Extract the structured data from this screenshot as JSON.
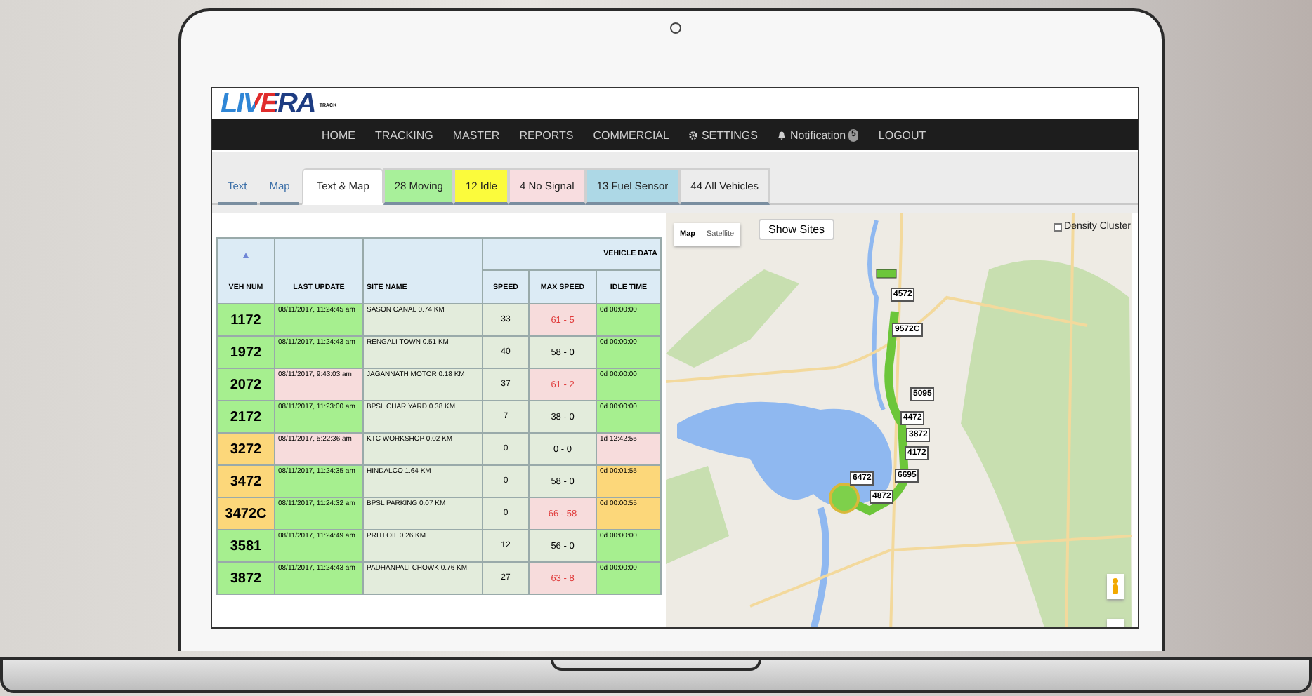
{
  "logo": {
    "brand": "LIVERA",
    "tagline": "TRACK"
  },
  "nav": [
    {
      "label": "HOME",
      "kind": "plain"
    },
    {
      "label": "TRACKING",
      "kind": "plain"
    },
    {
      "label": "MASTER",
      "kind": "plain"
    },
    {
      "label": "REPORTS",
      "kind": "plain"
    },
    {
      "label": "COMMERCIAL",
      "kind": "plain"
    },
    {
      "label": "SETTINGS",
      "kind": "gear"
    },
    {
      "label": "Notification",
      "kind": "bell",
      "badge": "5"
    },
    {
      "label": "LOGOUT",
      "kind": "plain"
    }
  ],
  "tabs": [
    {
      "label": "Text",
      "selected": false,
      "kind": "link"
    },
    {
      "label": "Map",
      "selected": false,
      "kind": "link"
    },
    {
      "label": "Text & Map",
      "selected": true,
      "kind": "tab"
    },
    {
      "label": "28 Moving",
      "selected": false,
      "kind": "tab",
      "color": "#a8f09a"
    },
    {
      "label": "12 Idle",
      "selected": false,
      "kind": "tab",
      "color": "#fbfb3c"
    },
    {
      "label": "4 No Signal",
      "selected": false,
      "kind": "tab",
      "color": "#f8dde0"
    },
    {
      "label": "13 Fuel Sensor",
      "selected": false,
      "kind": "tab",
      "color": "#add8e6"
    },
    {
      "label": "44 All Vehicles",
      "selected": false,
      "kind": "tab",
      "color": "#ececec"
    }
  ],
  "table": {
    "group_header": "VEHICLE DATA",
    "columns": [
      {
        "label": "VEH NUM",
        "sorted": true
      },
      {
        "label": "LAST UPDATE",
        "sorted": false
      },
      {
        "label": "SITE NAME",
        "sorted": false
      },
      {
        "label": "SPEED",
        "sorted": false
      },
      {
        "label": "MAX SPEED",
        "sorted": false
      },
      {
        "label": "IDLE TIME",
        "sorted": false
      }
    ],
    "rows": [
      {
        "veh_num": {
          "text": "1172",
          "color": "#a6ef8f"
        },
        "last_update": {
          "text": "08/11/2017, 11:24:45 am",
          "color": "#a6ef8f"
        },
        "site": "SASON CANAL 0.74 KM",
        "speed": "33",
        "max_speed": {
          "text": "61 - 5",
          "over_limit": true
        },
        "idle_time": {
          "text": "0d 00:00:00",
          "color": "#a6ef8f"
        }
      },
      {
        "veh_num": {
          "text": "1972",
          "color": "#a6ef8f"
        },
        "last_update": {
          "text": "08/11/2017, 11:24:43 am",
          "color": "#a6ef8f"
        },
        "site": "RENGALI TOWN 0.51 KM",
        "speed": "40",
        "max_speed": {
          "text": "58 - 0",
          "over_limit": false
        },
        "idle_time": {
          "text": "0d 00:00:00",
          "color": "#a6ef8f"
        }
      },
      {
        "veh_num": {
          "text": "2072",
          "color": "#a6ef8f"
        },
        "last_update": {
          "text": "08/11/2017, 9:43:03 am",
          "color": "#f7dcdc"
        },
        "site": "JAGANNATH MOTOR 0.18 KM",
        "speed": "37",
        "max_speed": {
          "text": "61 - 2",
          "over_limit": true
        },
        "idle_time": {
          "text": "0d 00:00:00",
          "color": "#a6ef8f"
        }
      },
      {
        "veh_num": {
          "text": "2172",
          "color": "#a6ef8f"
        },
        "last_update": {
          "text": "08/11/2017, 11:23:00 am",
          "color": "#a6ef8f"
        },
        "site": "BPSL CHAR YARD 0.38 KM",
        "speed": "7",
        "max_speed": {
          "text": "38 - 0",
          "over_limit": false
        },
        "idle_time": {
          "text": "0d 00:00:00",
          "color": "#a6ef8f"
        }
      },
      {
        "veh_num": {
          "text": "3272",
          "color": "#fcd77a"
        },
        "last_update": {
          "text": "08/11/2017, 5:22:36 am",
          "color": "#f7dcdc"
        },
        "site": "KTC WORKSHOP 0.02 KM",
        "speed": "0",
        "max_speed": {
          "text": "0 - 0",
          "over_limit": false
        },
        "idle_time": {
          "text": "1d 12:42:55",
          "color": "#f7dcdc"
        }
      },
      {
        "veh_num": {
          "text": "3472",
          "color": "#fcd77a"
        },
        "last_update": {
          "text": "08/11/2017, 11:24:35 am",
          "color": "#a6ef8f"
        },
        "site": "HINDALCO 1.64 KM",
        "speed": "0",
        "max_speed": {
          "text": "58 - 0",
          "over_limit": false
        },
        "idle_time": {
          "text": "0d 00:01:55",
          "color": "#fcd77a"
        }
      },
      {
        "veh_num": {
          "text": "3472C",
          "color": "#fcd77a"
        },
        "last_update": {
          "text": "08/11/2017, 11:24:32 am",
          "color": "#a6ef8f"
        },
        "site": "BPSL PARKING 0.07 KM",
        "speed": "0",
        "max_speed": {
          "text": "66 - 58",
          "over_limit": true
        },
        "idle_time": {
          "text": "0d 00:00:55",
          "color": "#fcd77a"
        }
      },
      {
        "veh_num": {
          "text": "3581",
          "color": "#a6ef8f"
        },
        "last_update": {
          "text": "08/11/2017, 11:24:49 am",
          "color": "#a6ef8f"
        },
        "site": "PRITI OIL 0.26 KM",
        "speed": "12",
        "max_speed": {
          "text": "56 - 0",
          "over_limit": false
        },
        "idle_time": {
          "text": "0d 00:00:00",
          "color": "#a6ef8f"
        }
      },
      {
        "veh_num": {
          "text": "3872",
          "color": "#a6ef8f"
        },
        "last_update": {
          "text": "08/11/2017, 11:24:43 am",
          "color": "#a6ef8f"
        },
        "site": "PADHANPALI CHOWK 0.76 KM",
        "speed": "27",
        "max_speed": {
          "text": "63 - 8",
          "over_limit": true
        },
        "idle_time": {
          "text": "0d 00:00:00",
          "color": "#a6ef8f"
        }
      }
    ]
  },
  "map": {
    "map_types": [
      {
        "label": "Map",
        "selected": true
      },
      {
        "label": "Satellite",
        "selected": false
      }
    ],
    "show_sites": "Show Sites",
    "density_cluster": {
      "label": "Density Cluster",
      "checked": false
    },
    "markers": [
      "4572",
      "9572C",
      "5095",
      "4472",
      "3872",
      "4172",
      "6472",
      "6695",
      "4872"
    ]
  }
}
